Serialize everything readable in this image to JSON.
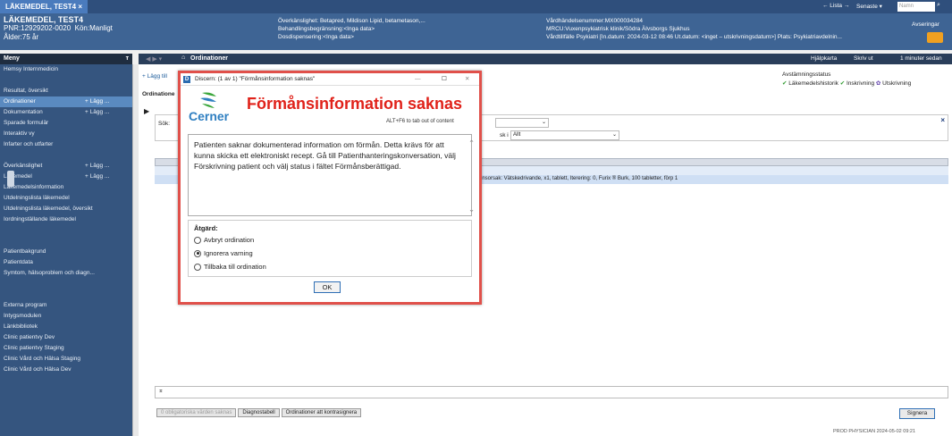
{
  "topbar": {
    "tab_name": "LÄKEMEDEL, TEST4",
    "nav_list": "← Lista →",
    "recent": "Senaste ▾",
    "search_placeholder": "Namn"
  },
  "patient": {
    "name": "LÄKEMEDEL, TEST4",
    "pnr": "PNR:12929202-0020",
    "gender": "Kön:Manligt",
    "age": "Ålder:75 år",
    "allergy": "Överkänslighet: Betapred, Mildison Lipid, betametason,...",
    "restriction": "Behandlingsbegränsning:<Inga data>",
    "dose": "Dosdispensering:<Inga data>",
    "episode_nr": "Vårdhändelsenummer:MX000034284",
    "mrcu": "MRCU:Vuxenpsykiatrisk klinik/Södra Älvsborgs Sjukhus",
    "episode": "Vårdtillfälle Psykiatri [In.datum: 2024-03-12 08:46 Ut.datum: <inget – utskrivningsdatum>] Plats: Psykiatriavdelnin...",
    "avserringar": "Avseringar"
  },
  "menu": {
    "header": "Meny",
    "items": [
      {
        "label": "Hemsy Internmedicin",
        "add": ""
      },
      {
        "label": "",
        "add": ""
      },
      {
        "label": "Resultat, översikt",
        "add": ""
      },
      {
        "label": "Ordinationer",
        "add": "+ Lägg ..."
      },
      {
        "label": "Dokumentation",
        "add": "+ Lägg ..."
      },
      {
        "label": "Sparade formulär",
        "add": ""
      },
      {
        "label": "Interaktiv vy",
        "add": ""
      },
      {
        "label": "Infarter och utfarter",
        "add": ""
      },
      {
        "label": "",
        "add": ""
      },
      {
        "label": "Överkänslighet",
        "add": "+ Lägg ..."
      },
      {
        "label": "Läkemedel",
        "add": "+ Lägg ..."
      },
      {
        "label": "Läkemedelsinformation",
        "add": ""
      },
      {
        "label": "Utdelningslista läkemedel",
        "add": ""
      },
      {
        "label": "Utdelningslista läkemedel, översikt",
        "add": ""
      },
      {
        "label": "Iordningställande läkemedel",
        "add": ""
      },
      {
        "label": "",
        "add": ""
      },
      {
        "label": "",
        "add": ""
      },
      {
        "label": "Patientbakgrund",
        "add": ""
      },
      {
        "label": "Patientdata",
        "add": ""
      },
      {
        "label": "Symtom, hälsoproblem och diagn...",
        "add": ""
      },
      {
        "label": "",
        "add": ""
      },
      {
        "label": "",
        "add": ""
      },
      {
        "label": "Externa program",
        "add": ""
      },
      {
        "label": "Intygsmodulen",
        "add": ""
      },
      {
        "label": "Länkbibliotek",
        "add": ""
      },
      {
        "label": "Clinic patientvy Dev",
        "add": ""
      },
      {
        "label": "Clinic patientvy Staging",
        "add": ""
      },
      {
        "label": "Clinic Vård och Hälsa Staging",
        "add": ""
      },
      {
        "label": "Clinic Vård och Hälsa Dev",
        "add": ""
      }
    ]
  },
  "page": {
    "title": "Ordinationer",
    "help": "Hjälpkarta",
    "print": "Skriv ut",
    "refreshed": "1 minuter sedan",
    "add_btn": "+ Lägg till",
    "section": "Ordinatione",
    "search_label": "Sök:",
    "filter_label": "sk i",
    "filter_value": "Allt",
    "reconcile_title": "Avstämningsstatus",
    "reconcile_history": "Läkemedelshistorik",
    "reconcile_in": "Inskrivning",
    "reconcile_out": "Utskrivning",
    "row_text": "onsorsak: Vätskedrivande, x1, tablett, Iterering: 0, Furix ® Burk, 100 tabletter, förp 1",
    "btn_missing": "0 obligatoriska värden saknas",
    "btn_diag": "Diagnostabell",
    "btn_cosign": "Ordinationer att kontrasignera",
    "btn_sign": "Signera",
    "status": "PROD  PHYSICIAN  2024-05-02  09:21"
  },
  "dialog": {
    "title": "Discern: (1 av 1) \"Förmånsinformation saknas\"",
    "logo_text": "Cerner",
    "heading": "Förmånsinformation saknas",
    "alt_hint": "ALT+F6 to tab out of content",
    "message": "Patienten saknar dokumenterad information om förmån. Detta krävs för att kunna skicka ett elektroniskt recept. Gå till Patienthanteringskonversation, välj Förskrivning patient och välj status i fältet Förmånsberättigad.",
    "action_label": "Åtgärd:",
    "options": [
      {
        "label": "Avbryt ordination",
        "selected": false
      },
      {
        "label": "Ignorera varning",
        "selected": true
      },
      {
        "label": "Tillbaka till ordination",
        "selected": false
      }
    ],
    "ok_label": "OK"
  },
  "colors": {
    "accent_red": "#e0221a",
    "frame": "#e0504a",
    "banner": "#3e6494",
    "menu": "#35557f"
  }
}
